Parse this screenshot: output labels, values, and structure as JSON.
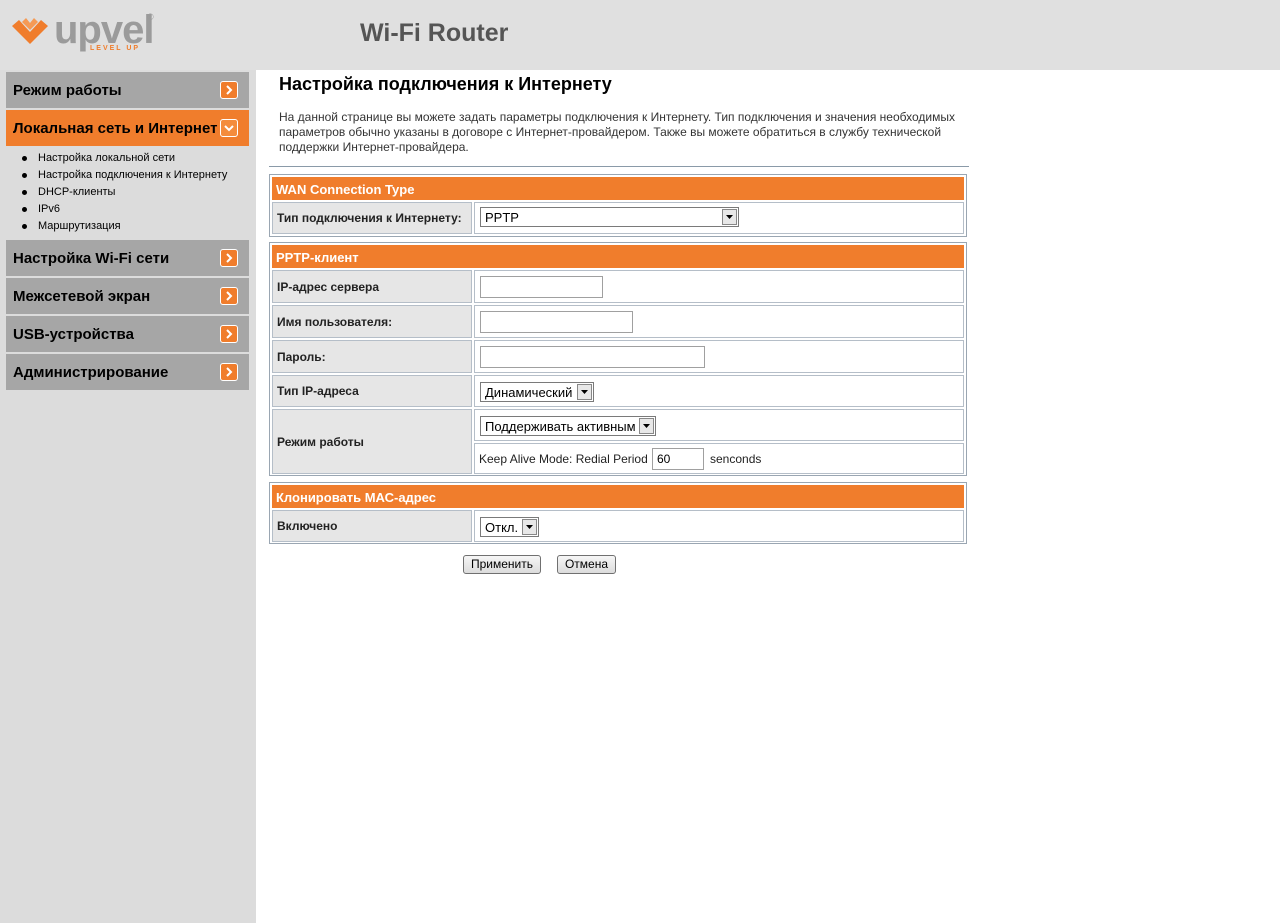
{
  "header": {
    "logo_word": "upvel",
    "logo_reg": "®",
    "logo_tagline": "LEVEL UP",
    "app_title": "Wi-Fi Router"
  },
  "sidebar": {
    "items": [
      {
        "label": "Режим работы",
        "icon": "chevron-right-icon"
      },
      {
        "label": "Локальная сеть и Интернет",
        "icon": "chevron-down-icon",
        "active": true
      },
      {
        "label": "Настройка Wi-Fi сети",
        "icon": "chevron-right-icon"
      },
      {
        "label": "Межсетевой экран",
        "icon": "chevron-right-icon"
      },
      {
        "label": "USB-устройства",
        "icon": "chevron-right-icon"
      },
      {
        "label": "Администрирование",
        "icon": "chevron-right-icon"
      }
    ],
    "subitems": [
      {
        "label": "Настройка локальной сети"
      },
      {
        "label": "Настройка подключения к Интернету"
      },
      {
        "label": "DHCP-клиенты"
      },
      {
        "label": "IPv6"
      },
      {
        "label": "Маршрутизация"
      }
    ]
  },
  "main": {
    "title": "Настройка подключения к Интернету",
    "description": "На данной странице вы можете задать параметры подключения к Интернету. Тип подключения и значения необходимых параметров обычно указаны в договоре с Интернет-провайдером. Также вы можете обратиться в службу технической поддержки Интернет-провайдера.",
    "wan": {
      "header": "WAN Connection Type",
      "conn_type_label": "Тип подключения к Интернету:",
      "conn_type_value": "PPTP"
    },
    "pptp": {
      "header": "PPTP-клиент",
      "server_ip_label": "IP-адрес сервера",
      "server_ip_value": "",
      "username_label": "Имя пользователя:",
      "username_value": "",
      "password_label": "Пароль:",
      "password_value": "",
      "ip_type_label": "Тип IP-адреса",
      "ip_type_value": "Динамический",
      "mode_label": "Режим работы",
      "mode_value": "Поддерживать активным",
      "keepalive_label": "Keep Alive Mode: Redial Period",
      "keepalive_value": "60",
      "keepalive_unit": "senconds"
    },
    "mac": {
      "header": "Клонировать МАС-адрес",
      "enabled_label": "Включено",
      "enabled_value": "Откл."
    },
    "buttons": {
      "apply": "Применить",
      "cancel": "Отмена"
    }
  },
  "colors": {
    "accent": "#f07d2c",
    "sidebar_bg": "#dcdcdc",
    "nav_item_bg": "#a6a6a6",
    "header_bg": "#e0e0e0"
  }
}
